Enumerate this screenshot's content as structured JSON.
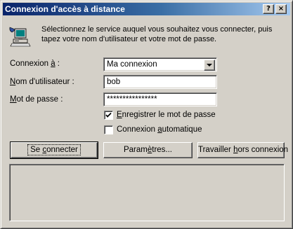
{
  "window": {
    "title": "Connexion d'accès à distance",
    "help_glyph": "?",
    "close_glyph": "×"
  },
  "intro": {
    "icon": "computer-network-icon",
    "text": "Sélectionnez le service auquel vous souhaitez vous connecter, puis tapez votre nom d'utilisateur et votre mot de passe."
  },
  "form": {
    "connect_to": {
      "label_prefix": "Connexion ",
      "label_key": "à",
      "label_suffix": " :",
      "value": "Ma connexion"
    },
    "username": {
      "label_key": "N",
      "label_rest": "om d'utilisateur :",
      "value": "bob"
    },
    "password": {
      "label_key": "M",
      "label_rest": "ot de passe :",
      "value": "****************"
    }
  },
  "options": {
    "save_password": {
      "label_key": "E",
      "label_rest": "nregistrer le mot de passe",
      "checked": true
    },
    "auto_connect": {
      "label_prefix": "Connexion ",
      "label_key": "a",
      "label_rest": "utomatique",
      "checked": false
    }
  },
  "buttons": {
    "connect": {
      "label_prefix": "Se ",
      "label_key": "c",
      "label_rest": "onnecter"
    },
    "settings": {
      "label_prefix": "Param",
      "label_key": "è",
      "label_rest": "tres..."
    },
    "offline": {
      "label_prefix": "Travailler ",
      "label_key": "h",
      "label_rest": "ors connexion"
    }
  },
  "status": {
    "text": ""
  },
  "colors": {
    "titlebar_start": "#0a246a",
    "titlebar_end": "#a6caf0",
    "face": "#d4d0c8"
  }
}
